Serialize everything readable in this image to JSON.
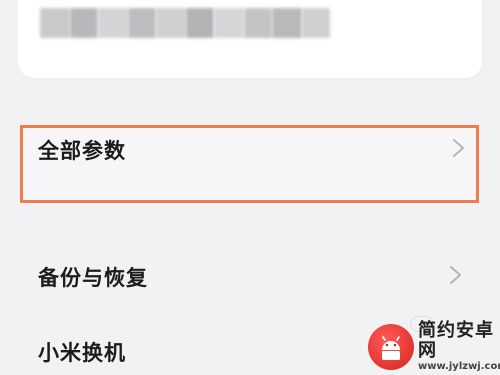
{
  "settings_list": {
    "all_params_label": "全部参数",
    "backup_restore_label": "备份与恢复",
    "mi_mover_label": "小米换机"
  },
  "watermark": {
    "title": "简约安卓网",
    "url": "www.jylzwj.com"
  },
  "colors": {
    "highlight_border": "#ee7d4c",
    "background": "#f2f2f4",
    "chevron": "#b5b5b8"
  }
}
